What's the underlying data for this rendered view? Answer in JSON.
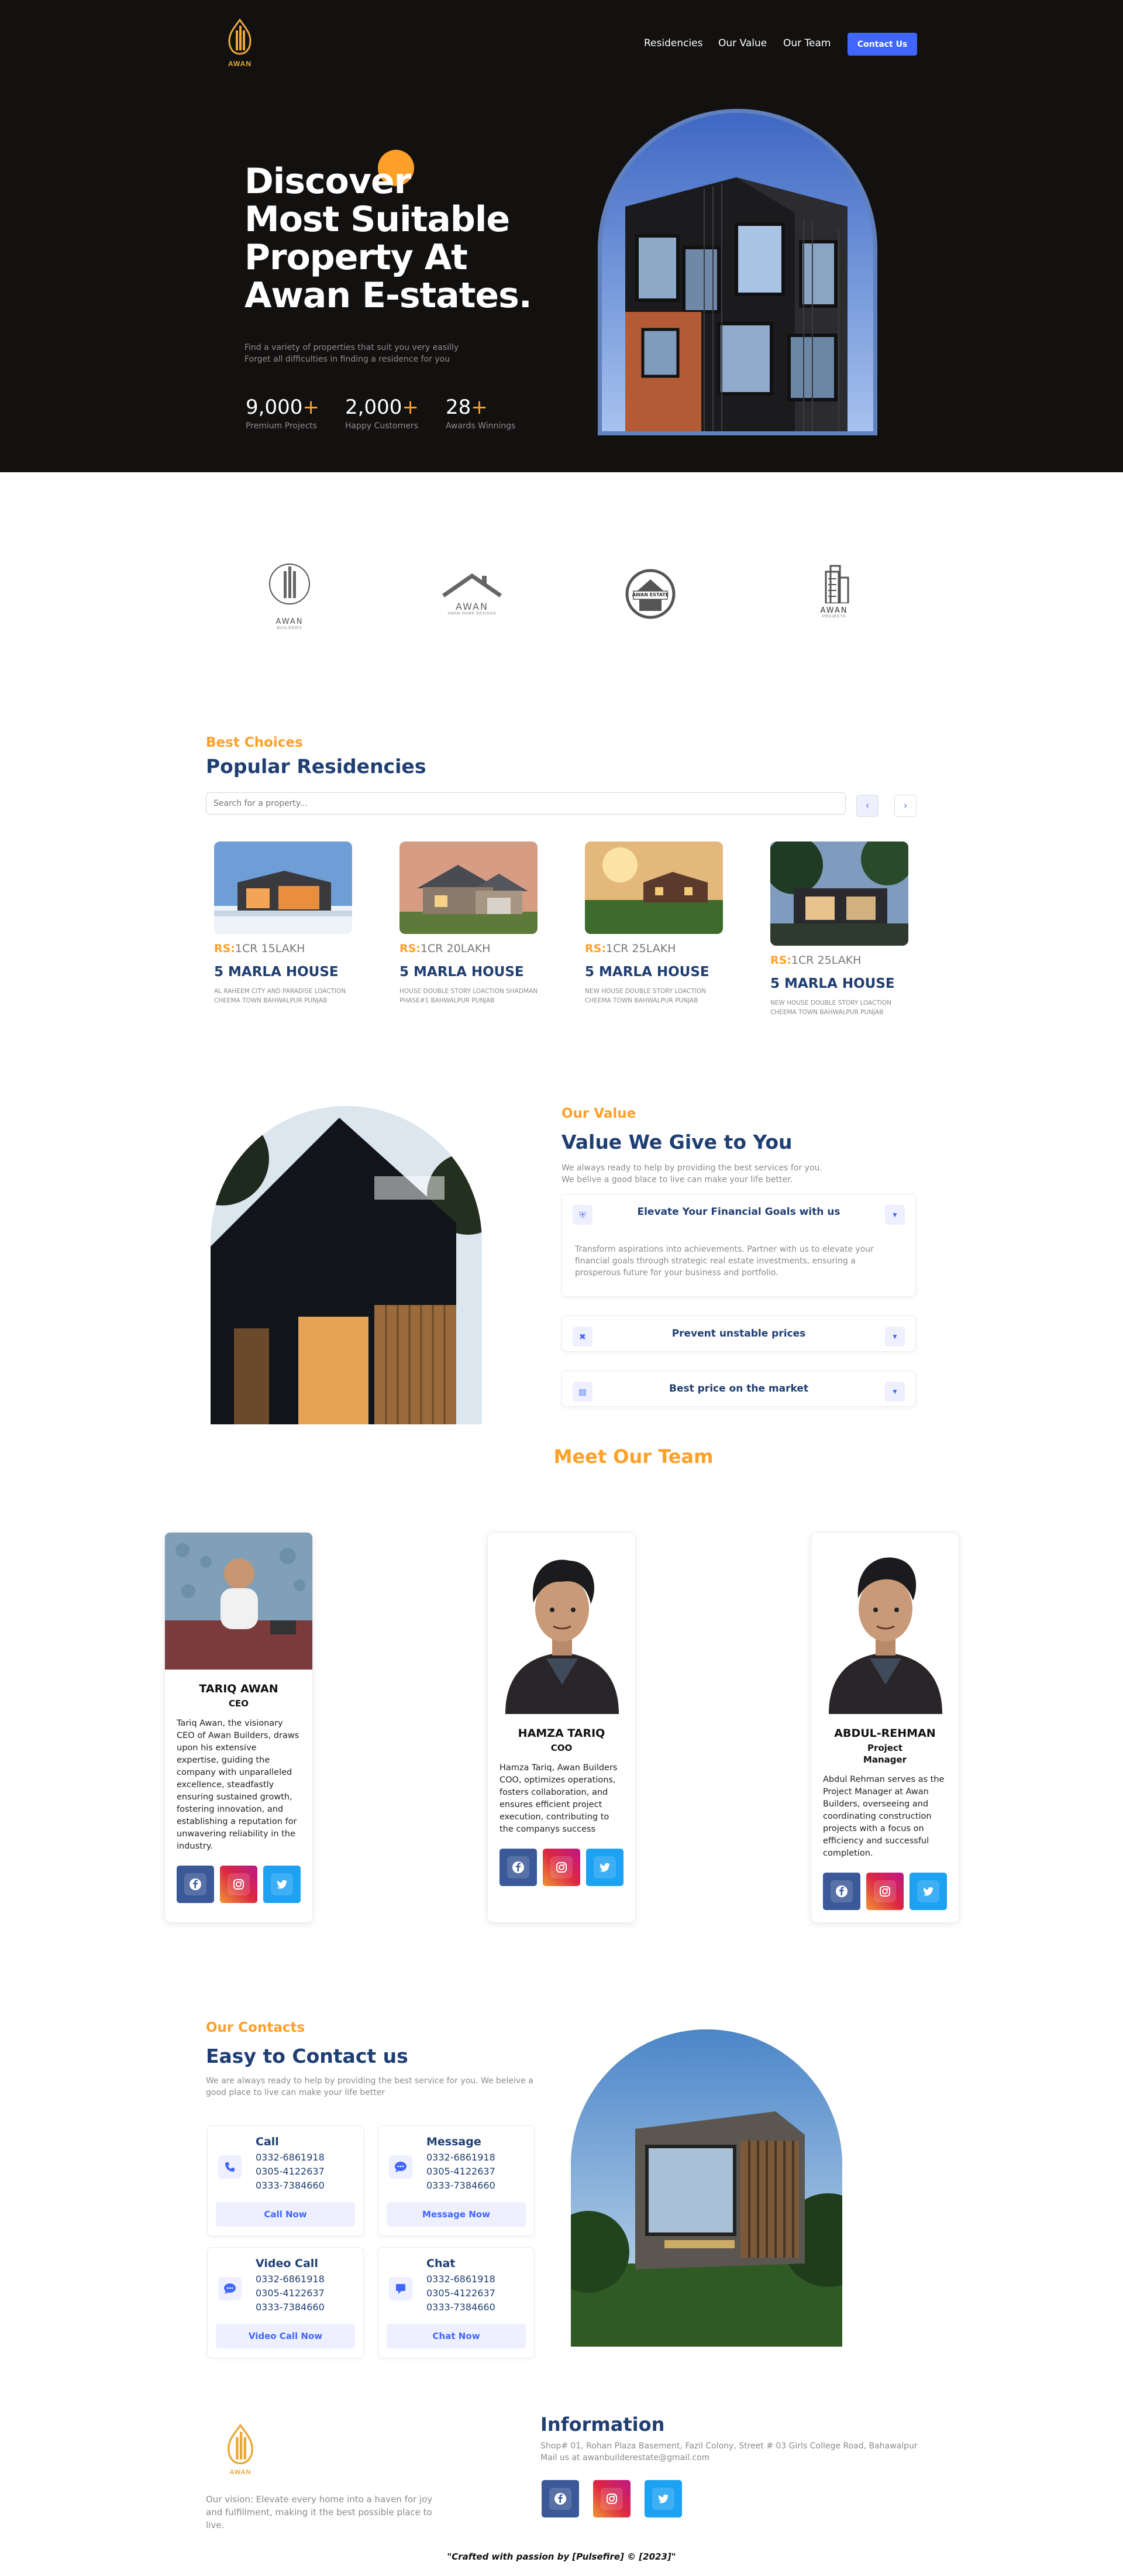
{
  "brand": {
    "logo_text": "AWAN"
  },
  "nav": {
    "items": [
      "Residencies",
      "Our Value",
      "Our Team"
    ],
    "contact_label": "Contact Us"
  },
  "hero": {
    "title_lines": [
      "Discover",
      "Most Suitable",
      "Property At",
      "Awan E-states."
    ],
    "description_lines": [
      "Find a variety of properties that suit you very easilly",
      "Forget all difficulties in finding a residence for you"
    ],
    "stats": [
      {
        "value": "9,000",
        "suffix": "+",
        "label": "Premium Projects"
      },
      {
        "value": "2,000",
        "suffix": "+",
        "label": "Happy Customers"
      },
      {
        "value": "28",
        "suffix": "+",
        "label": "Awards Winnings"
      }
    ]
  },
  "partners": [
    {
      "name": "AWAN",
      "sub": "BUILDERS"
    },
    {
      "name": "AWAN",
      "sub": "AWAN HOME DESIGNS"
    },
    {
      "name": "AWAN ESTATE",
      "sub": ""
    },
    {
      "name": "AWAN",
      "sub": "PROJECTS"
    }
  ],
  "residencies": {
    "subtitle": "Best Choices",
    "title": "Popular Residencies",
    "search_placeholder": "Search for a property...",
    "prev_icon": "chevron-left-icon",
    "next_icon": "chevron-right-icon",
    "cards": [
      {
        "currency": "RS:",
        "price": "1CR 15LAKH",
        "name": "5 MARLA HOUSE",
        "desc": "AL RAHEEM CITY AND PARADISE LOACTION CHEEMA TOWN BAHWALPUR PUNJAB"
      },
      {
        "currency": "RS:",
        "price": "1CR 20LAKH",
        "name": "5 MARLA HOUSE",
        "desc": "HOUSE DOUBLE STORY LOACTION SHADMAN PHASE#1 BAHWALPUR PUNJAB"
      },
      {
        "currency": "RS:",
        "price": "1CR 25LAKH",
        "name": "5 MARLA HOUSE",
        "desc": "NEW HOUSE DOUBLE STORY LOACTION CHEEMA TOWN BAHWALPUR PUNJAB"
      },
      {
        "currency": "RS:",
        "price": "1CR 25LAKH",
        "name": "5 MARLA HOUSE",
        "desc": "NEW HOUSE DOUBLE STORY LOACTION CHEEMA TOWN BAHWALPUR PUNJAB"
      }
    ]
  },
  "value": {
    "subtitle": "Our Value",
    "title": "Value We Give to You",
    "desc_lines": [
      "We always ready to help by providing the best services for you.",
      "We belive a good blace to live can make your life better."
    ],
    "items": [
      {
        "icon": "shield-icon",
        "title": "Elevate Your Financial Goals with us",
        "expanded": true,
        "body": "Transform aspirations into achievements. Partner with us to elevate your financial goals through strategic real estate investments, ensuring a prosperous future for your business and portfolio."
      },
      {
        "icon": "close-circle-icon",
        "title": "Prevent unstable prices",
        "expanded": false
      },
      {
        "icon": "document-icon",
        "title": "Best price on the market",
        "expanded": false
      }
    ]
  },
  "team": {
    "title": "Meet Our Team",
    "members": [
      {
        "name": "TARIQ AWAN",
        "role": "CEO",
        "bio": "Tariq Awan, the visionary CEO of Awan Builders, draws upon his extensive expertise, guiding the company with unparalleled excellence, steadfastly ensuring sustained growth, fostering innovation, and establishing a reputation for unwavering reliability in the industry."
      },
      {
        "name": "HAMZA TARIQ",
        "role": "COO",
        "bio": "Hamza Tariq, Awan Builders COO, optimizes operations, fosters collaboration, and ensures efficient project execution, contributing to the companys success"
      },
      {
        "name": "ABDUL-REHMAN",
        "role": "Project Manager",
        "bio": "Abdul Rehman serves as the Project Manager at Awan Builders, overseeing and coordinating construction projects with a focus on efficiency and successful completion."
      }
    ],
    "social_icons": [
      "facebook-icon",
      "instagram-icon",
      "twitter-icon"
    ]
  },
  "contacts": {
    "subtitle": "Our Contacts",
    "title": "Easy to Contact us",
    "desc_lines": [
      "We are always ready to help by providing the best service for you. We beleive a",
      "good place to live can make your life better"
    ],
    "cards": [
      {
        "icon": "phone-icon",
        "title": "Call",
        "numbers": [
          "0332-6861918",
          "0305-4122637",
          "0333-7384660"
        ],
        "button": "Call Now"
      },
      {
        "icon": "message-icon",
        "title": "Message",
        "numbers": [
          "0332-6861918",
          "0305-4122637",
          "0333-7384660"
        ],
        "button": "Message Now"
      },
      {
        "icon": "video-call-icon",
        "title": "Video Call",
        "numbers": [
          "0332-6861918",
          "0305-4122637",
          "0333-7384660"
        ],
        "button": "Video Call Now"
      },
      {
        "icon": "chat-icon",
        "title": "Chat",
        "numbers": [
          "0332-6861918",
          "0305-4122637",
          "0333-7384660"
        ],
        "button": "Chat Now"
      }
    ]
  },
  "footer": {
    "logo_text": "AWAN",
    "vision_lines": [
      "Our vision: Elevate every home into a haven for joy",
      "and fulfillment, making it the best possible place to live."
    ],
    "info_title": "Information",
    "address_lines": [
      "Shop# 01, Rohan Plaza Basement, Fazil Colony, Street # 03 Girls College Road, Bahawalpur",
      "Mail us at awanbuilderestate@gmail.com"
    ],
    "credit": "\"Crafted with passion by [Pulsefire] © [2023]\""
  },
  "colors": {
    "accent_orange": "#ffa028",
    "navy": "#1f3e72",
    "blue": "#4066ff",
    "hero_bg": "#131110"
  }
}
